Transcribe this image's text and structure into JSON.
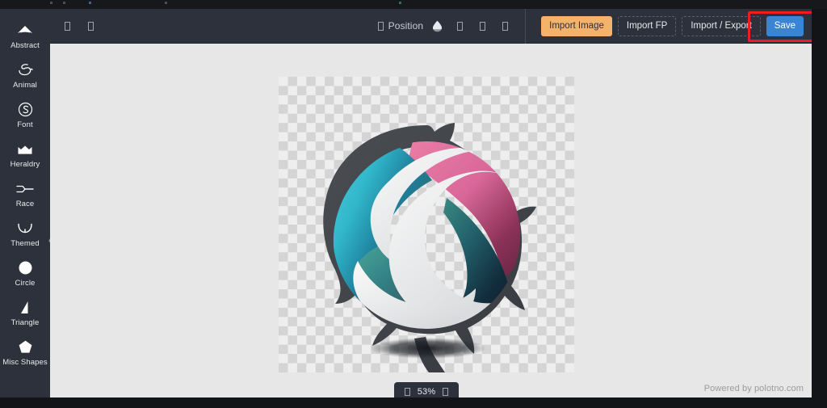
{
  "app": {
    "name": "polotno-editor",
    "footer_credit": "Powered by polotno.com"
  },
  "colors": {
    "sidebar_bg": "#2c313c",
    "toolbar_bg": "#2c313c",
    "workspace_bg": "#e7e7e7",
    "import_image_btn": "#f5b26b",
    "save_btn": "#3a84d4",
    "highlight_outline": "#ee1c23",
    "checker_light": "#eeeeee",
    "checker_dark": "#d4d4d4"
  },
  "sidebar": {
    "collapse_handle_icon": "chevron-left-icon",
    "items": [
      {
        "label": "Abstract",
        "icon": "abstract-icon"
      },
      {
        "label": "Animal",
        "icon": "animal-icon"
      },
      {
        "label": "Font",
        "icon": "font-icon"
      },
      {
        "label": "Heraldry",
        "icon": "heraldry-crown-icon"
      },
      {
        "label": "Race",
        "icon": "race-icon"
      },
      {
        "label": "Themed",
        "icon": "themed-arc-icon"
      },
      {
        "label": "Circle",
        "icon": "circle-icon"
      },
      {
        "label": "Triangle",
        "icon": "triangle-icon"
      },
      {
        "label": "Misc Shapes",
        "icon": "misc-shapes-icon"
      }
    ]
  },
  "toolbar": {
    "left_glyphs": [
      {
        "name": "undo-icon",
        "glyph": "missing-glyph-box"
      },
      {
        "name": "redo-icon",
        "glyph": "missing-glyph-box"
      }
    ],
    "position_glyph": "missing-glyph-box",
    "position_label": "Position",
    "opacity_icon": "droplet-opacity-icon",
    "right_glyphs": [
      {
        "name": "duplicate-icon",
        "glyph": "missing-glyph-box"
      },
      {
        "name": "lock-icon",
        "glyph": "missing-glyph-box"
      },
      {
        "name": "delete-icon",
        "glyph": "missing-glyph-box"
      }
    ],
    "buttons": [
      {
        "label": "Import Image",
        "style": "primary-orange"
      },
      {
        "label": "Import FP",
        "style": "ghost"
      },
      {
        "label": "Import / Export",
        "style": "ghost",
        "highlighted": true
      },
      {
        "label": "Save",
        "style": "primary-blue"
      }
    ]
  },
  "canvas": {
    "artwork_name": "s-sphere-brush-ring-logo",
    "artwork_description": "Spherical S-monogram logo with teal, cyan, pink and dark-navy gradient ribbons inside a dark grey brush-stroke ring",
    "transparent_background": true
  },
  "zoom_control": {
    "zoom_out_icon": "missing-glyph-box",
    "value": "53%",
    "zoom_in_icon": "missing-glyph-box"
  }
}
